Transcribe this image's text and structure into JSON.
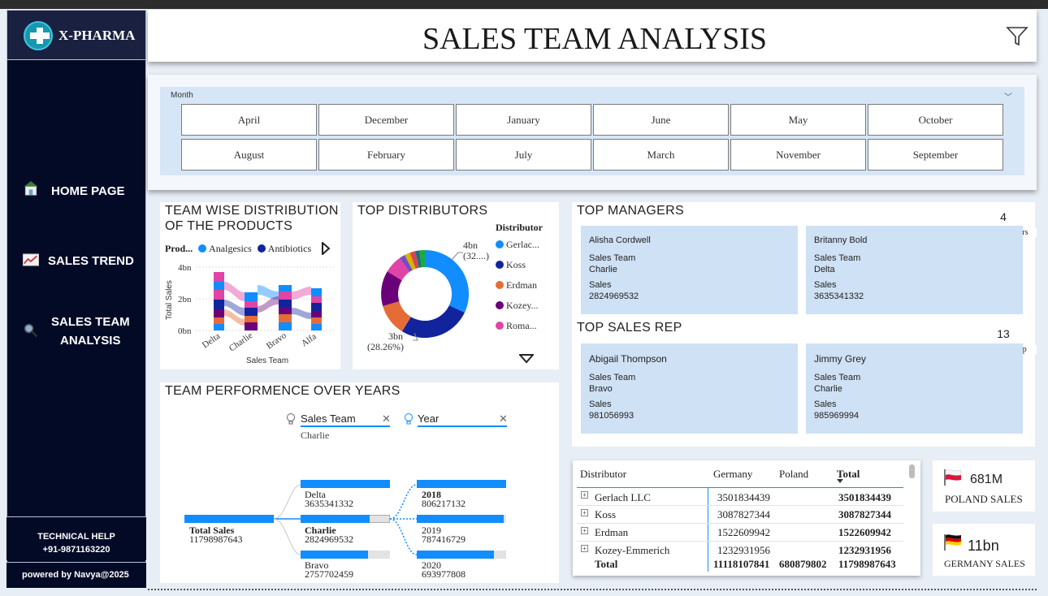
{
  "app": {
    "logo_text": "X-PHARMA",
    "title": "SALES TEAM ANALYSIS"
  },
  "sidebar": {
    "items": [
      {
        "label": "HOME PAGE"
      },
      {
        "label": "SALES TREND"
      },
      {
        "label_line1": "SALES TEAM",
        "label_line2": "ANALYSIS"
      }
    ],
    "help_title": "TECHNICAL HELP",
    "help_phone": "+91-9871163220",
    "powered": "powered by Navya@2025"
  },
  "month_slicer": {
    "label": "Month",
    "row1": [
      "April",
      "December",
      "January",
      "June",
      "May",
      "October"
    ],
    "row2": [
      "August",
      "February",
      "July",
      "March",
      "November",
      "September"
    ]
  },
  "team_dist": {
    "title_line1": "TEAM WISE DISTRIBUTION",
    "title_line2": "OF THE PRODUCTS",
    "legend_prefix": "Prod...",
    "legend": [
      "Analgesics",
      "Antibiotics"
    ],
    "legend_colors": [
      "#118dff",
      "#12239e"
    ],
    "ylabel": "Total Sales",
    "xlabel": "Sales Team",
    "yticks": [
      "4bn",
      "2bn",
      "0bn"
    ],
    "categories": [
      "Delta",
      "Charlie",
      "Bravo",
      "Alfa"
    ]
  },
  "top_distributors": {
    "title": "TOP DISTRIBUTORS",
    "legend_title": "Distributor",
    "legend": [
      "Gerlac...",
      "Koss",
      "Erdman",
      "Kozey...",
      "Roma..."
    ],
    "colors": [
      "#118dff",
      "#12239e",
      "#e66c37",
      "#6b007b",
      "#e044a7"
    ],
    "label_top_1": "4bn",
    "label_top_2": "(32....)",
    "label_bot_1": "3bn",
    "label_bot_2": "(28.26%)"
  },
  "top_managers": {
    "title": "TOP MANAGERS",
    "count": "4",
    "count_label": "Total managers",
    "cards": [
      {
        "name": "Alisha Cordwell",
        "team_label": "Sales Team",
        "team": "Charlie",
        "sales_label": "Sales",
        "sales": "2824969532"
      },
      {
        "name": "Britanny Bold",
        "team_label": "Sales Team",
        "team": "Delta",
        "sales_label": "Sales",
        "sales": "3635341332"
      }
    ]
  },
  "top_sales_rep": {
    "title": "TOP SALES REP",
    "count": "13",
    "count_label": "Total sales rep",
    "cards": [
      {
        "name": "Abigail Thompson",
        "team_label": "Sales Team",
        "team": "Bravo",
        "sales_label": "Sales",
        "sales": "981056993"
      },
      {
        "name": "Jimmy Grey",
        "team_label": "Sales Team",
        "team": "Charlie",
        "sales_label": "Sales",
        "sales": "985969994"
      }
    ]
  },
  "team_perf": {
    "title": "TEAM PERFORMENCE OVER YEARS",
    "field1": "Sales Team",
    "field1_value": "Charlie",
    "field2": "Year",
    "root_label": "Total Sales",
    "root_value": "11798987643",
    "teams": [
      {
        "name": "Delta",
        "value": "3635341332"
      },
      {
        "name": "Charlie",
        "value": "2824969532"
      },
      {
        "name": "Bravo",
        "value": "2757702459"
      }
    ],
    "years": [
      {
        "name": "2018",
        "value": "806217132"
      },
      {
        "name": "2019",
        "value": "787416729"
      },
      {
        "name": "2020",
        "value": "693977808"
      }
    ]
  },
  "table": {
    "headers": [
      "Distributor",
      "Germany",
      "Poland",
      "Total"
    ],
    "rows": [
      {
        "name": "Gerlach LLC",
        "germany": "3501834439",
        "poland": "",
        "total": "3501834439"
      },
      {
        "name": "Koss",
        "germany": "3087827344",
        "poland": "",
        "total": "3087827344"
      },
      {
        "name": "Erdman",
        "germany": "1522609942",
        "poland": "",
        "total": "1522609942"
      },
      {
        "name": "Kozey-Emmerich",
        "germany": "1232931956",
        "poland": "",
        "total": "1232931956"
      }
    ],
    "total_row": {
      "name": "Total",
      "germany": "11118107841",
      "poland": "680879802",
      "total": "11798987643"
    }
  },
  "kpis": {
    "poland_value": "681M",
    "poland_label": "POLAND SALES",
    "germany_value": "11bn",
    "germany_label": "GERMANY SALES"
  }
}
